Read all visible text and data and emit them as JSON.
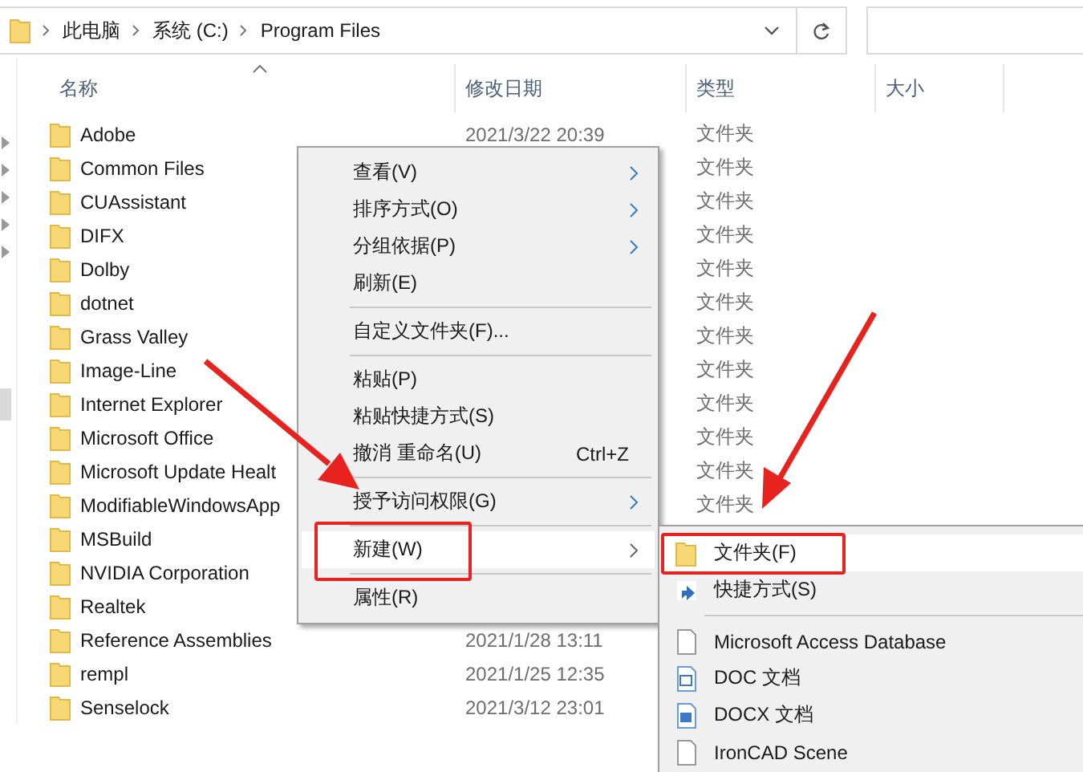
{
  "address_bar": {
    "breadcrumbs": [
      "此电脑",
      "系统 (C:)",
      "Program Files"
    ]
  },
  "columns": [
    {
      "label": "名称",
      "sorted": true
    },
    {
      "label": "修改日期",
      "sorted": false
    },
    {
      "label": "类型",
      "sorted": false
    },
    {
      "label": "大小",
      "sorted": false
    }
  ],
  "rows": [
    {
      "name": "Adobe",
      "date": "2021/3/22 20:39",
      "type": "文件夹"
    },
    {
      "name": "Common Files",
      "type": "文件夹"
    },
    {
      "name": "CUAssistant",
      "type": "文件夹"
    },
    {
      "name": "DIFX",
      "type": "文件夹"
    },
    {
      "name": "Dolby",
      "type": "文件夹"
    },
    {
      "name": "dotnet",
      "type": "文件夹"
    },
    {
      "name": "Grass Valley",
      "type": "文件夹"
    },
    {
      "name": "Image-Line",
      "type": "文件夹"
    },
    {
      "name": "Internet Explorer",
      "type": "文件夹"
    },
    {
      "name": "Microsoft Office",
      "type": "文件夹"
    },
    {
      "name": "Microsoft Update Healt",
      "type": "文件夹"
    },
    {
      "name": "ModifiableWindowsApp",
      "type": "文件夹"
    },
    {
      "name": "MSBuild"
    },
    {
      "name": "NVIDIA Corporation"
    },
    {
      "name": "Realtek"
    },
    {
      "name": "Reference Assemblies",
      "date": "2021/1/28 13:11"
    },
    {
      "name": "rempl",
      "date": "2021/1/25 12:35"
    },
    {
      "name": "Senselock",
      "date": "2021/3/12 23:01"
    }
  ],
  "context_menu": [
    {
      "kind": "item",
      "label": "查看(V)",
      "submenu": true,
      "selected": false
    },
    {
      "kind": "item",
      "label": "排序方式(O)",
      "submenu": true,
      "selected": false
    },
    {
      "kind": "item",
      "label": "分组依据(P)",
      "submenu": true,
      "selected": false
    },
    {
      "kind": "item",
      "label": "刷新(E)",
      "submenu": false,
      "selected": false
    },
    {
      "kind": "separator"
    },
    {
      "kind": "item",
      "label": "自定义文件夹(F)...",
      "submenu": false,
      "selected": false
    },
    {
      "kind": "separator"
    },
    {
      "kind": "item",
      "label": "粘贴(P)",
      "submenu": false,
      "selected": false
    },
    {
      "kind": "item",
      "label": "粘贴快捷方式(S)",
      "submenu": false,
      "selected": false
    },
    {
      "kind": "item",
      "label": "撤消 重命名(U)",
      "shortcut": "Ctrl+Z",
      "submenu": false,
      "selected": false
    },
    {
      "kind": "separator"
    },
    {
      "kind": "item",
      "label": "授予访问权限(G)",
      "submenu": true,
      "selected": false
    },
    {
      "kind": "separator"
    },
    {
      "kind": "item",
      "label": "新建(W)",
      "submenu": true,
      "selected": true
    },
    {
      "kind": "separator"
    },
    {
      "kind": "item",
      "label": "属性(R)",
      "submenu": false,
      "selected": false
    }
  ],
  "new_submenu": [
    {
      "kind": "folder",
      "label": "文件夹(F)",
      "selected": true
    },
    {
      "kind": "shortcut",
      "label": "快捷方式(S)",
      "selected": false
    },
    {
      "kind": "separator"
    },
    {
      "kind": "blank",
      "label": "Microsoft Access Database",
      "selected": false
    },
    {
      "kind": "doc",
      "label": "DOC 文档",
      "selected": false
    },
    {
      "kind": "docx",
      "label": "DOCX 文档",
      "selected": false
    },
    {
      "kind": "blank",
      "label": "IronCAD Scene",
      "selected": false
    }
  ]
}
